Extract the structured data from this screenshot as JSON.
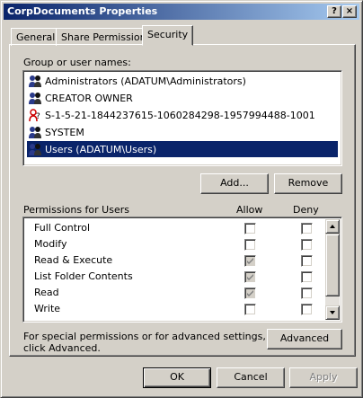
{
  "window": {
    "title": "CorpDocuments Properties",
    "help_glyph": "?",
    "close_glyph": "×"
  },
  "tabs": [
    {
      "label": "General",
      "active": false
    },
    {
      "label": "Share Permissions",
      "active": false
    },
    {
      "label": "Security",
      "active": true
    }
  ],
  "users_section": {
    "label": "Group or user names:",
    "items": [
      {
        "name": "Administrators (ADATUM\\Administrators)",
        "icon": "group-icon",
        "selected": false
      },
      {
        "name": "CREATOR OWNER",
        "icon": "group-icon",
        "selected": false
      },
      {
        "name": "S-1-5-21-1844237615-1060284298-1957994488-1001",
        "icon": "unknown-user-icon",
        "selected": false
      },
      {
        "name": "SYSTEM",
        "icon": "group-icon",
        "selected": false
      },
      {
        "name": "Users (ADATUM\\Users)",
        "icon": "group-icon",
        "selected": true
      }
    ]
  },
  "buttons": {
    "add": "Add...",
    "remove": "Remove",
    "advanced": "Advanced",
    "ok": "OK",
    "cancel": "Cancel",
    "apply": "Apply"
  },
  "permissions": {
    "label": "Permissions for Users",
    "allow_header": "Allow",
    "deny_header": "Deny",
    "rows": [
      {
        "name": "Full Control",
        "allow": false,
        "allow_inherited": false,
        "deny": false
      },
      {
        "name": "Modify",
        "allow": false,
        "allow_inherited": false,
        "deny": false
      },
      {
        "name": "Read & Execute",
        "allow": true,
        "allow_inherited": true,
        "deny": false
      },
      {
        "name": "List Folder Contents",
        "allow": true,
        "allow_inherited": true,
        "deny": false
      },
      {
        "name": "Read",
        "allow": true,
        "allow_inherited": true,
        "deny": false
      },
      {
        "name": "Write",
        "allow": false,
        "allow_inherited": false,
        "deny": false
      }
    ]
  },
  "advanced_note": {
    "line1": "For special permissions or for advanced settings,",
    "line2": "click Advanced."
  },
  "colors": {
    "title_start": "#0a246a",
    "title_end": "#a6caf0",
    "face": "#d4d0c8",
    "selection": "#0a246a"
  }
}
